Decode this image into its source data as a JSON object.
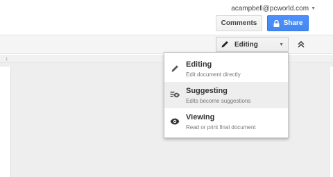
{
  "header": {
    "account_email": "acampbell@pcworld.com",
    "comments_label": "Comments",
    "share_label": "Share"
  },
  "toolbar": {
    "mode_label": "Editing"
  },
  "ruler": {
    "tick_label": "1"
  },
  "mode_menu": {
    "items": [
      {
        "title": "Editing",
        "subtitle": "Edit document directly",
        "icon": "pencil-icon"
      },
      {
        "title": "Suggesting",
        "subtitle": "Edits become suggestions",
        "icon": "suggest-icon"
      },
      {
        "title": "Viewing",
        "subtitle": "Read or print final document",
        "icon": "eye-icon"
      }
    ],
    "hovered_index": 1
  },
  "colors": {
    "share_blue": "#4d90fe",
    "menu_hover": "#eeeeee"
  }
}
